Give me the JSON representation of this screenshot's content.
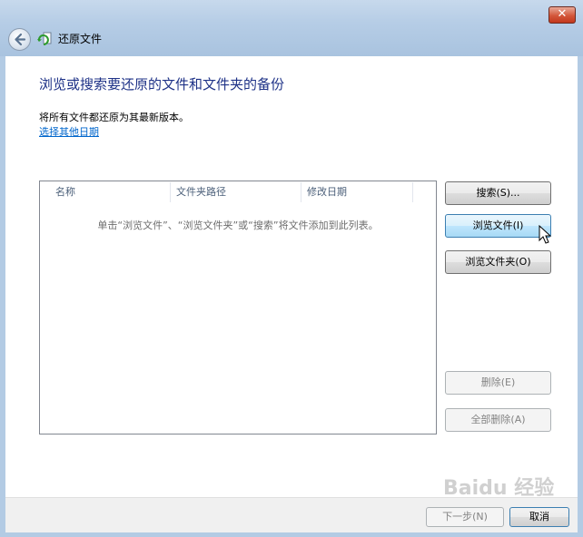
{
  "window": {
    "title": "还原文件",
    "close_label": "✕"
  },
  "main": {
    "heading": "浏览或搜索要还原的文件和文件夹的备份",
    "info_text": "将所有文件都还原为其最新版本。",
    "choose_date_link": "选择其他日期"
  },
  "list": {
    "columns": [
      "名称",
      "文件夹路径",
      "修改日期"
    ],
    "empty_message": "单击“浏览文件”、“浏览文件夹”或“搜索”将文件添加到此列表。"
  },
  "buttons": {
    "search": "搜索(S)...",
    "browse_files": "浏览文件(I)",
    "browse_folders": "浏览文件夹(O)",
    "delete": "删除(E)",
    "delete_all": "全部删除(A)"
  },
  "footer": {
    "next": "下一步(N)",
    "cancel": "取消"
  },
  "watermark": "Baidu 经验",
  "icons": {
    "back": "back-arrow-icon",
    "app": "restore-files-icon",
    "cursor": "mouse-pointer-icon"
  }
}
